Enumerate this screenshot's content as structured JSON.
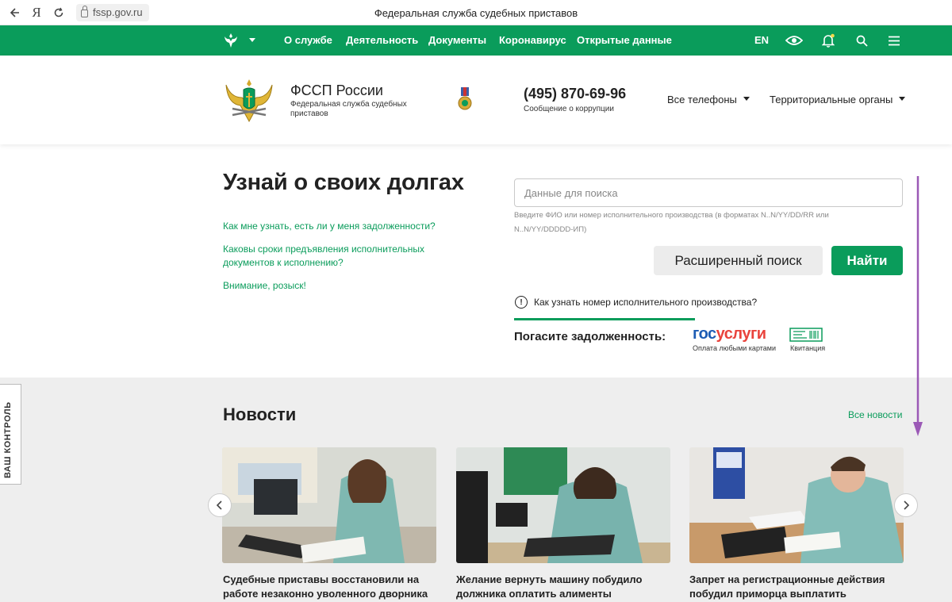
{
  "browser": {
    "url": "fssp.gov.ru",
    "tab_title": "Федеральная служба судебных приставов",
    "back_icon": "arrow-left-icon",
    "yandex_label": "Я",
    "reload_icon": "reload-icon"
  },
  "nav": {
    "items": [
      "О службе",
      "Деятельность",
      "Документы",
      "Коронавирус",
      "Открытые данные"
    ],
    "lang": "EN",
    "icons": [
      "eye-icon",
      "bell-icon",
      "search-icon",
      "menu-icon"
    ]
  },
  "header": {
    "title": "ФССП России",
    "subtitle": "Федеральная служба судебных приставов",
    "phone": "(495) 870-69-96",
    "phone_note": "Сообщение о коррупции",
    "dropdown_phones": "Все телефоны",
    "dropdown_regions": "Территориальные органы"
  },
  "hero": {
    "title": "Узнай о своих долгах",
    "links": [
      "Как мне узнать, есть ли у меня задолженности?",
      "Каковы сроки предъявления исполнительных документов к исполнению?",
      "Внимание, розыск!"
    ],
    "search_placeholder": "Данные для поиска",
    "search_hint": "Введите ФИО или номер исполнительного производства (в форматах N..N/YY/DD/RR или N..N/YY/DDDDD-ИП)",
    "advanced_button": "Расширенный поиск",
    "find_button": "Найти",
    "info_link": "Как узнать номер исполнительного производства?",
    "pay_label": "Погасите задолженность:",
    "gosuslugi_a": "гос",
    "gosuslugi_b": "услуги",
    "gosuslugi_sub": "Оплата любыми картами",
    "kvit_label": "Квитанция"
  },
  "news": {
    "title": "Новости",
    "all_link": "Все новости",
    "side_tab": "ВАШ КОНТРОЛЬ",
    "cards": [
      {
        "title": "Судебные приставы восстановили на работе незаконно уволенного дворника"
      },
      {
        "title": "Желание вернуть машину побудило должника оплатить алименты"
      },
      {
        "title": "Запрет на регистрационные действия побудил приморца выплатить"
      }
    ]
  },
  "colors": {
    "brand_green": "#0a9c5b",
    "annotation_purple": "#9b59b6",
    "gos_blue": "#1d5cb4",
    "gos_red": "#e9433c"
  }
}
